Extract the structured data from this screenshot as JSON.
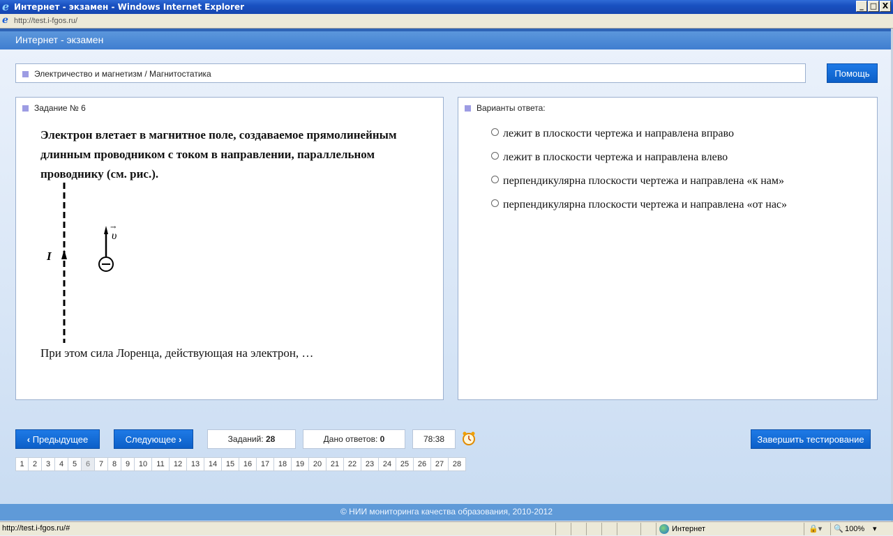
{
  "window": {
    "title": "Интернет - экзамен - Windows Internet Explorer",
    "address": "http://test.i-fgos.ru/",
    "buttons": {
      "minimize": "_",
      "maximize": "□",
      "close": "X"
    }
  },
  "app": {
    "title": "Интернет - экзамен",
    "breadcrumb": "Электричество и магнетизм / Магнитостатика",
    "help_label": "Помощь"
  },
  "question": {
    "header": "Задание № 6",
    "text": "Электрон влетает в магнитное поле, создаваемое прямолинейным длинным проводником с током в направлении, параллельном проводнику (см. рис.).",
    "figure": {
      "current_label": "I",
      "velocity_label": "υ",
      "vector_arrow": "→"
    },
    "tail": "При этом сила Лоренца, действующая на электрон, …"
  },
  "answers": {
    "header": "Варианты ответа:",
    "options": [
      "лежит в плоскости чертежа и направлена вправо",
      "лежит в плоскости чертежа и направлена влево",
      "перпендикулярна плоскости чертежа и направлена «к нам»",
      "перпендикулярна плоскости чертежа и направлена «от нас»"
    ]
  },
  "nav": {
    "prev_label": "Предыдущее",
    "next_label": "Следующее",
    "total_label": "Заданий:",
    "total_value": "28",
    "answered_label": "Дано ответов:",
    "answered_value": "0",
    "timer": "78:38",
    "finish_label": "Завершить тестирование",
    "pages": [
      "1",
      "2",
      "3",
      "4",
      "5",
      "6",
      "7",
      "8",
      "9",
      "10",
      "11",
      "12",
      "13",
      "14",
      "15",
      "16",
      "17",
      "18",
      "19",
      "20",
      "21",
      "22",
      "23",
      "24",
      "25",
      "26",
      "27",
      "28"
    ],
    "current_page": "6"
  },
  "footer": {
    "copyright": "© НИИ мониторинга качества образования, 2010-2012"
  },
  "statusbar": {
    "url": "http://test.i-fgos.ru/#",
    "zone": "Интернет",
    "zoom": "100%"
  }
}
